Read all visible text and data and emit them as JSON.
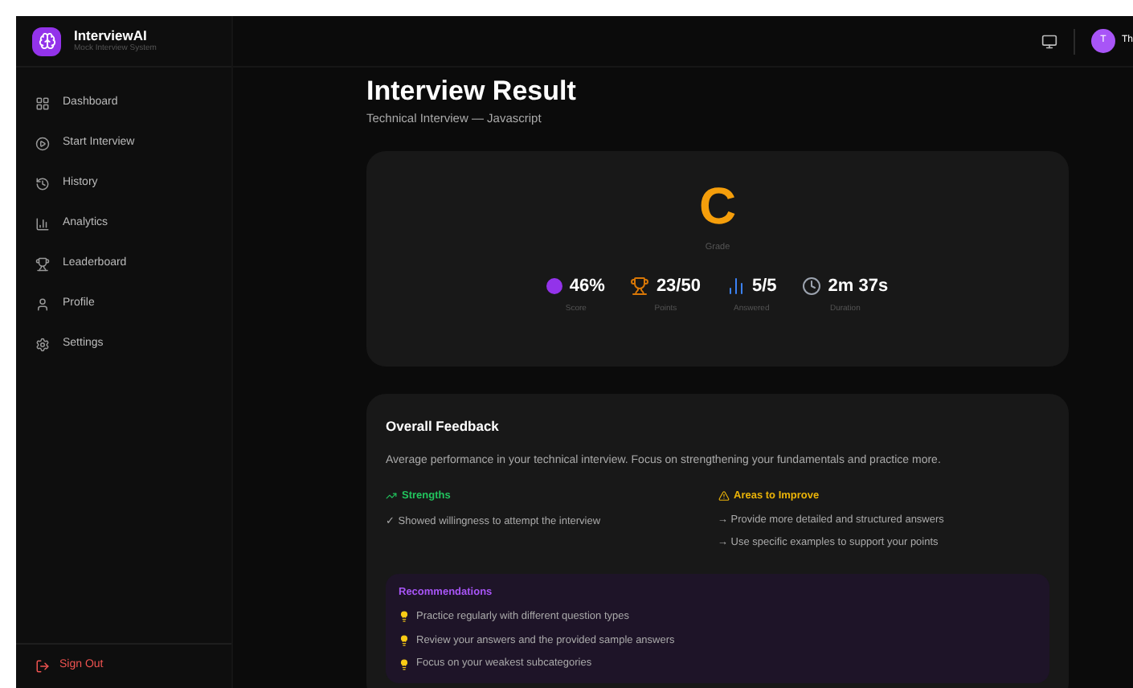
{
  "brand": {
    "name": "InterviewAI",
    "tagline": "Mock Interview System"
  },
  "sidebar": {
    "items": [
      {
        "label": "Dashboard",
        "kind": "grid",
        "selected": false
      },
      {
        "label": "Start Interview",
        "kind": "play",
        "selected": false
      },
      {
        "label": "History",
        "kind": "history",
        "selected": false
      },
      {
        "label": "Analytics",
        "kind": "chart",
        "selected": false
      },
      {
        "label": "Leaderboard",
        "kind": "trophy",
        "selected": false
      },
      {
        "label": "Profile",
        "kind": "user",
        "selected": false
      },
      {
        "label": "Settings",
        "kind": "gear",
        "selected": false
      }
    ],
    "sign_out": "Sign Out"
  },
  "header": {
    "avatar": "T",
    "user_name": "Th"
  },
  "page": {
    "title": "Interview Result",
    "subtitle": "Technical Interview — Javascript"
  },
  "result": {
    "grade": "C",
    "grade_label": "Grade",
    "stats": [
      {
        "kind": "score",
        "value": "46%",
        "label": "Score",
        "color": "#9333ea"
      },
      {
        "kind": "points",
        "value": "23/50",
        "label": "Points",
        "color": "#d97706"
      },
      {
        "kind": "answered",
        "value": "5/5",
        "label": "Answered",
        "color": "#3b82f6"
      },
      {
        "kind": "duration",
        "value": "2m 37s",
        "label": "Duration",
        "color": "#9ca3af"
      }
    ]
  },
  "feedback": {
    "title": "Overall Feedback",
    "summary": "Average performance in your technical interview. Focus on strengthening your fundamentals and practice more.",
    "strengths": {
      "title": "Strengths",
      "items": [
        "✓ Showed willingness to attempt the interview"
      ]
    },
    "improve": {
      "title": "Areas to Improve",
      "items": [
        "→ Provide more detailed and structured answers",
        "→ Use specific examples to support your points"
      ]
    },
    "recommendations": {
      "title": "Recommendations",
      "items": [
        "Practice regularly with different question types",
        "Review your answers and the provided sample answers",
        "Focus on your weakest subcategories"
      ]
    }
  }
}
